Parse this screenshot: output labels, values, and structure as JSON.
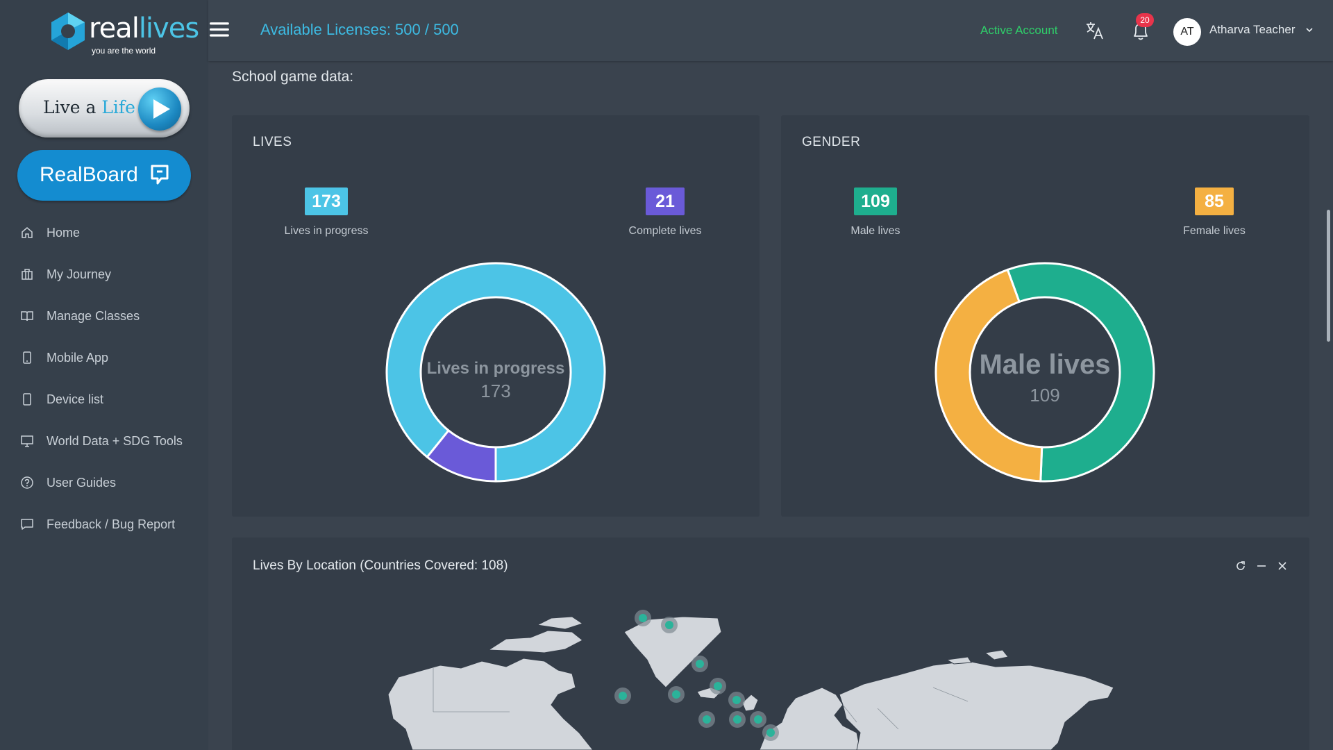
{
  "brand": {
    "word_prefix": "real",
    "word_suffix": "lives",
    "tagline": "you are the world"
  },
  "sidebar": {
    "live_button": {
      "prefix": "Live a ",
      "highlight": "Life"
    },
    "realboard_button": "RealBoard",
    "items": [
      {
        "label": "Home",
        "icon": "home-icon"
      },
      {
        "label": "My Journey",
        "icon": "briefcase-icon"
      },
      {
        "label": "Manage Classes",
        "icon": "book-icon"
      },
      {
        "label": "Mobile App",
        "icon": "mobile-icon"
      },
      {
        "label": "Device list",
        "icon": "device-icon"
      },
      {
        "label": "World Data + SDG Tools",
        "icon": "monitor-icon"
      },
      {
        "label": "User Guides",
        "icon": "help-circle-icon"
      },
      {
        "label": "Feedback / Bug Report",
        "icon": "chat-icon"
      }
    ]
  },
  "header": {
    "licenses": "Available Licenses: 500 / 500",
    "account_status": "Active Account",
    "notification_count": "20",
    "avatar_initials": "AT",
    "user_name": "Atharva Teacher"
  },
  "main": {
    "section_title": "School game data:",
    "lives": {
      "title": "LIVES",
      "stats": [
        {
          "value": "173",
          "label": "Lives in progress",
          "color": "#4cc4e6"
        },
        {
          "value": "21",
          "label": "Complete lives",
          "color": "#6a5ad8"
        }
      ],
      "center_label": "Lives in progress",
      "center_value": "173"
    },
    "gender": {
      "title": "GENDER",
      "stats": [
        {
          "value": "109",
          "label": "Male lives",
          "color": "#1eae8e"
        },
        {
          "value": "85",
          "label": "Female lives",
          "color": "#f4b042"
        }
      ],
      "center_label": "Male lives",
      "center_value": "109"
    },
    "map": {
      "title": "Lives By Location (Countries Covered: 108)",
      "tools": [
        "refresh-icon",
        "minimize-icon",
        "close-icon"
      ]
    }
  },
  "chart_data": [
    {
      "type": "pie",
      "categories": [
        "Lives in progress",
        "Complete lives"
      ],
      "values": [
        173,
        21
      ],
      "colors": [
        "#4cc4e6",
        "#6a5ad8"
      ],
      "title": "LIVES"
    },
    {
      "type": "pie",
      "categories": [
        "Male lives",
        "Female lives"
      ],
      "values": [
        109,
        85
      ],
      "colors": [
        "#1eae8e",
        "#f4b042"
      ],
      "title": "GENDER"
    }
  ]
}
